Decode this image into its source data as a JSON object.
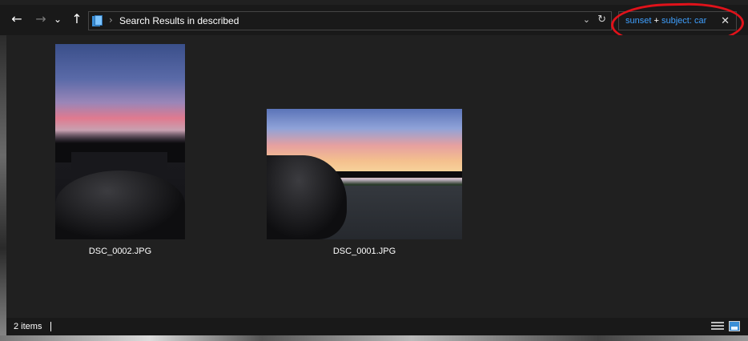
{
  "navbar": {
    "back_icon": "arrow-left-icon",
    "forward_icon": "arrow-right-icon",
    "recent_icon": "chevron-down-icon",
    "up_icon": "arrow-up-icon",
    "back_glyph": "←",
    "forward_glyph": "→",
    "recent_glyph": "⌄",
    "up_glyph": "↑"
  },
  "address_bar": {
    "folder_icon": "search-results-folder-icon",
    "separator": "›",
    "location": "Search Results in described",
    "dropdown_glyph": "⌄",
    "refresh_glyph": "↻"
  },
  "search": {
    "term1": "sunset",
    "operator": "+",
    "term2": "subject: car",
    "clear_glyph": "✕",
    "term_color": "#3fa0ff",
    "highlight_color": "#e0121a"
  },
  "files": [
    {
      "name": "DSC_0002.JPG",
      "orientation": "portrait"
    },
    {
      "name": "DSC_0001.JPG",
      "orientation": "landscape"
    }
  ],
  "status": {
    "item_count": "2 items"
  }
}
